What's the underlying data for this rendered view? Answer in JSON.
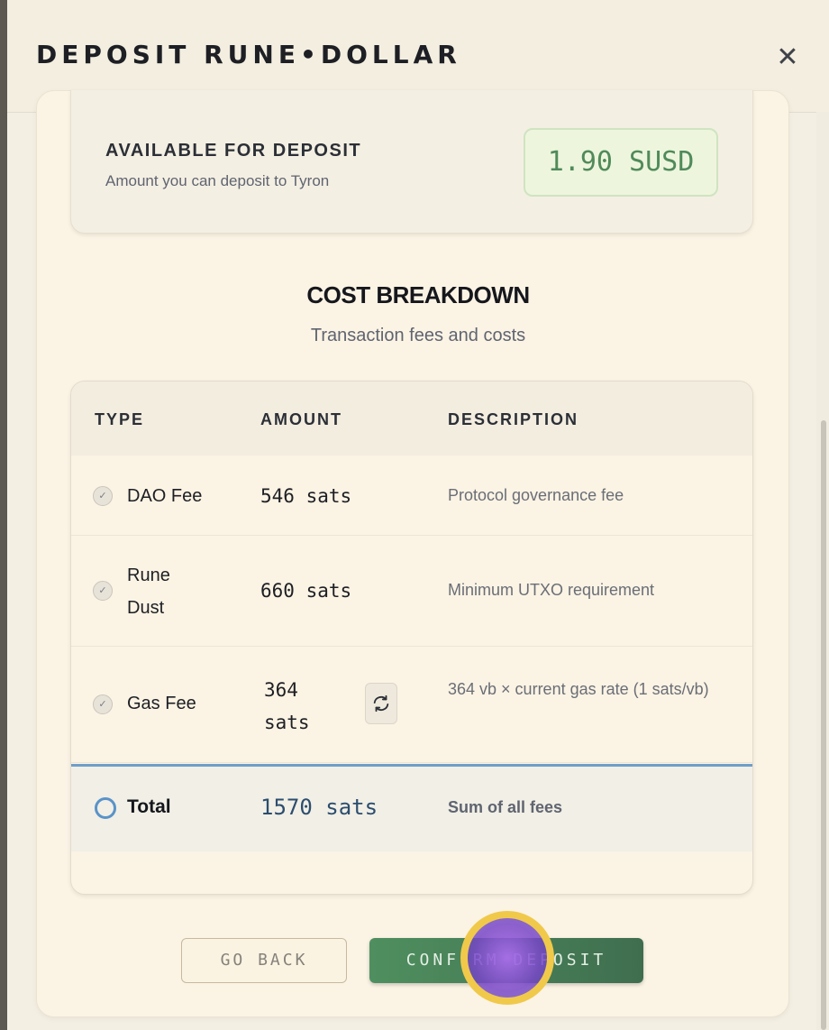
{
  "modal": {
    "title": "DEPOSIT RUNE•DOLLAR",
    "close_label": "✕"
  },
  "available": {
    "title": "AVAILABLE FOR DEPOSIT",
    "subtitle": "Amount you can deposit to Tyron",
    "amount": "1.90 SUSD"
  },
  "cost": {
    "title": "COST BREAKDOWN",
    "subtitle": "Transaction fees and costs"
  },
  "table": {
    "headers": [
      "TYPE",
      "AMOUNT",
      "DESCRIPTION"
    ],
    "rows": [
      {
        "type": "DAO Fee",
        "amount": "546 sats",
        "description": "Protocol governance fee"
      },
      {
        "type": "Rune Dust",
        "amount": "660 sats",
        "description": "Minimum UTXO requirement"
      },
      {
        "type": "Gas Fee",
        "amount": "364 sats",
        "description": "364 vb × current gas rate (1 sats/vb)"
      }
    ],
    "total": {
      "type": "Total",
      "amount": "1570 sats",
      "description": "Sum of all fees"
    }
  },
  "buttons": {
    "back": "GO BACK",
    "confirm": "CONFIRM DEPOSIT"
  },
  "colors": {
    "accent_green": "#4f8f5f",
    "badge_text": "#4f8b5a",
    "total_border": "#6e9fc8"
  },
  "icons": {
    "check": "check-circle-icon",
    "refresh": "refresh-icon",
    "close": "close-icon"
  }
}
